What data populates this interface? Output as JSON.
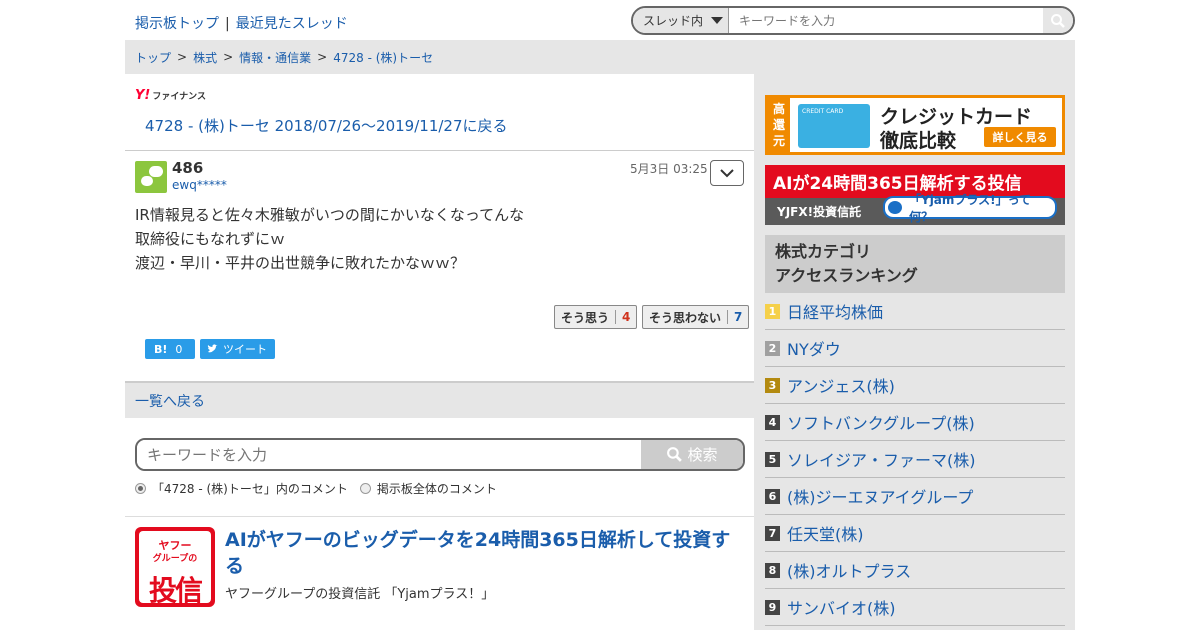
{
  "topnav": {
    "board_top": "掲示板トップ",
    "sep": "|",
    "recent": "最近見たスレッド"
  },
  "search_top": {
    "scope": "スレッド内",
    "placeholder": "キーワードを入力"
  },
  "breadcrumb": [
    {
      "label": "トップ"
    },
    {
      "label": "株式"
    },
    {
      "label": "情報・通信業"
    },
    {
      "label": "4728 - (株)トーセ"
    }
  ],
  "breadcrumb_sep": ">",
  "logo": {
    "mark": "Y!",
    "text": "ファイナンス"
  },
  "thread_back_link": "4728 - (株)トーセ 2018/07/26〜2019/11/27に戻る",
  "post": {
    "number": "486",
    "user": "ewq*****",
    "date": "5月3日 03:25",
    "body": [
      "IR情報見ると佐々木雅敏がいつの間にかいなくなってんな",
      "取締役にもなれずにｗ",
      "渡辺・早川・平井の出世競争に敗れたかなｗｗ？"
    ],
    "vote_yes_label": "そう思う",
    "vote_yes_count": "4",
    "vote_no_label": "そう思わない",
    "vote_no_count": "7"
  },
  "share": {
    "hatena_label": "B!",
    "hatena_count": "0",
    "tweet_label": "ツイート"
  },
  "back_to_list": "一覧へ戻る",
  "search_bottom": {
    "placeholder": "キーワードを入力",
    "button": "検索"
  },
  "search_scope": {
    "option1": "「4728 - (株)トーセ」内のコメント",
    "option2": "掲示板全体のコメント"
  },
  "ad": {
    "logo_line1": "ヤフー",
    "logo_line2": "グループの",
    "logo_line3": "投信",
    "title": "AIがヤフーのビッグデータを24時間365日解析して投資する",
    "subtitle": "ヤフーグループの投資信託 「Yjamプラス！」"
  },
  "sidebar": {
    "banner1": {
      "side": "高還元",
      "card": "CREDIT CARD",
      "line1": "クレジットカード",
      "line2": "徹底比較",
      "button": "詳しく見る"
    },
    "banner2": {
      "headline": "AIが24時間365日解析する投信",
      "brand": "YJFX!投資信託",
      "pill": "「Yjamプラス!」って何？"
    },
    "ranking_title_1": "株式カテゴリ",
    "ranking_title_2": "アクセスランキング",
    "ranking": [
      {
        "rank": "1",
        "name": "日経平均株価",
        "color": "#f5d04a"
      },
      {
        "rank": "2",
        "name": "NYダウ",
        "color": "#a0a0a0"
      },
      {
        "rank": "3",
        "name": "アンジェス(株)",
        "color": "#b38a10"
      },
      {
        "rank": "4",
        "name": "ソフトバンクグループ(株)",
        "color": "#444444"
      },
      {
        "rank": "5",
        "name": "ソレイジア・ファーマ(株)",
        "color": "#444444"
      },
      {
        "rank": "6",
        "name": "(株)ジーエヌアイグループ",
        "color": "#444444"
      },
      {
        "rank": "7",
        "name": "任天堂(株)",
        "color": "#444444"
      },
      {
        "rank": "8",
        "name": "(株)オルトプラス",
        "color": "#444444"
      },
      {
        "rank": "9",
        "name": "サンバイオ(株)",
        "color": "#444444"
      }
    ]
  }
}
